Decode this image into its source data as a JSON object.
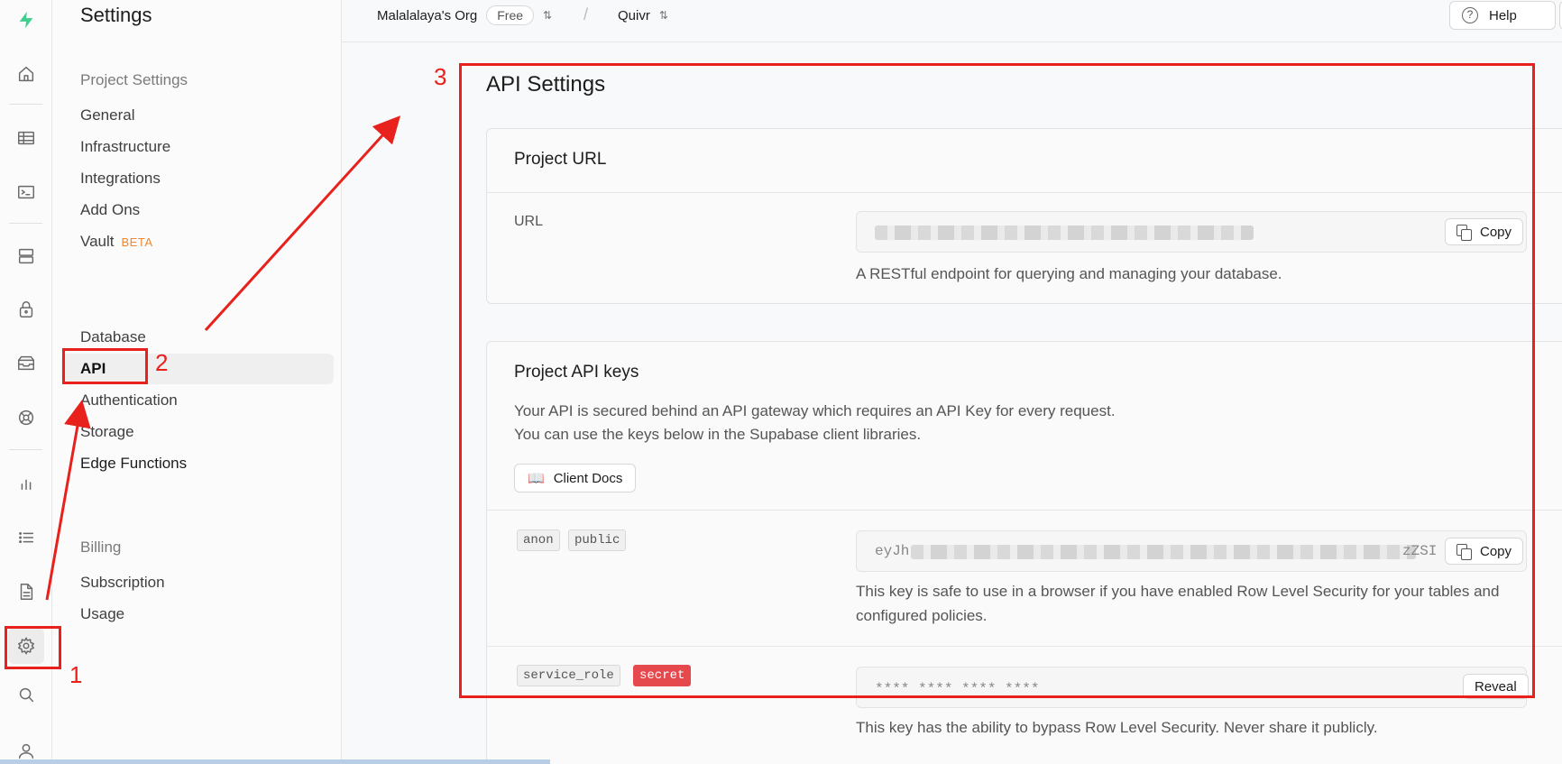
{
  "rail": {
    "icons": [
      "supabase-logo-icon",
      "home-icon",
      "table-editor-icon",
      "sql-editor-icon",
      "database-icon",
      "auth-lock-icon",
      "storage-icon",
      "realtime-icon",
      "reports-icon",
      "logs-icon",
      "docs-icon",
      "settings-icon",
      "search-icon",
      "user-icon"
    ]
  },
  "sidebar": {
    "title": "Settings",
    "project_settings_header": "Project Settings",
    "project_items": [
      "General",
      "Infrastructure",
      "Integrations",
      "Add Ons",
      "Vault"
    ],
    "vault_badge": "BETA",
    "config_items": [
      "Database",
      "API",
      "Authentication",
      "Storage",
      "Edge Functions"
    ],
    "billing_header": "Billing",
    "billing_items": [
      "Subscription",
      "Usage"
    ]
  },
  "topbar": {
    "org": "Malalalaya's Org",
    "plan": "Free",
    "separator": "/",
    "project": "Quivr",
    "help": "Help"
  },
  "main": {
    "title": "API Settings",
    "url_card": {
      "title": "Project URL",
      "label": "URL",
      "copy": "Copy",
      "description": "A RESTful endpoint for querying and managing your database."
    },
    "keys_card": {
      "title": "Project API keys",
      "desc_line1": "Your API is secured behind an API gateway which requires an API Key for every request.",
      "desc_line2": "You can use the keys below in the Supabase client libraries.",
      "docs_button": "Client Docs",
      "anon_tags": [
        "anon",
        "public"
      ],
      "anon_prefix": "eyJh",
      "anon_suffix": "zZSI",
      "anon_copy": "Copy",
      "anon_desc_line1": "This key is safe to use in a browser if you have enabled Row Level Security for your tables and",
      "anon_desc_line2": "configured policies.",
      "service_tags": [
        "service_role",
        "secret"
      ],
      "service_masked": "**** **** **** ****",
      "reveal": "Reveal",
      "service_desc": "This key has the ability to bypass Row Level Security. Never share it publicly."
    }
  },
  "annotations": {
    "step1": "1",
    "step2": "2",
    "step3": "3",
    "color": "#e8211c"
  }
}
